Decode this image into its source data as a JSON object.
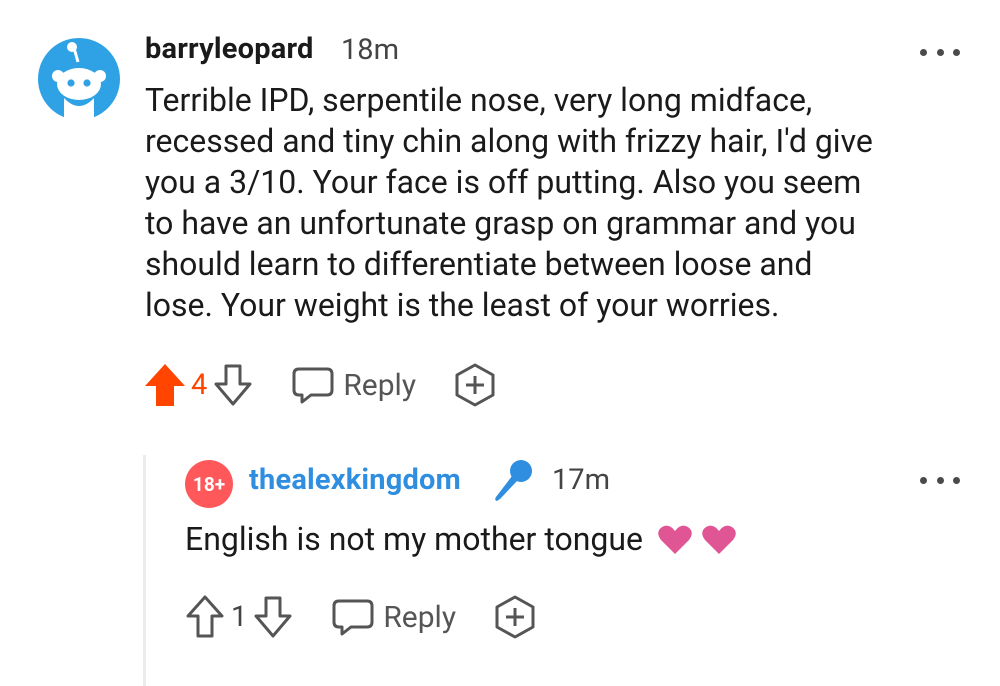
{
  "comment": {
    "username": "barryleopard",
    "timestamp": "18m",
    "body_lines": [
      "Terrible IPD, serpentile nose, very long midface,",
      "recessed and tiny chin along with frizzy hair, I'd give",
      "you a 3/10. Your face is off putting. Also you seem",
      "to have an unfortunate grasp on grammar and you",
      "should learn to differentiate between loose and",
      "lose. Your weight is the least of your worries."
    ],
    "vote_count": "4",
    "reply_label": "Reply",
    "upvoted": true
  },
  "reply": {
    "badge": "18+",
    "username": "thealexkingdom",
    "timestamp": "17m",
    "body": "English is not my mother tongue",
    "vote_count": "1",
    "reply_label": "Reply"
  },
  "colors": {
    "upvote_active": "#ff4500",
    "username_link": "#2f8ee0",
    "badge": "#ff585b",
    "heart": "#e05694",
    "icon_gray": "#555555"
  }
}
